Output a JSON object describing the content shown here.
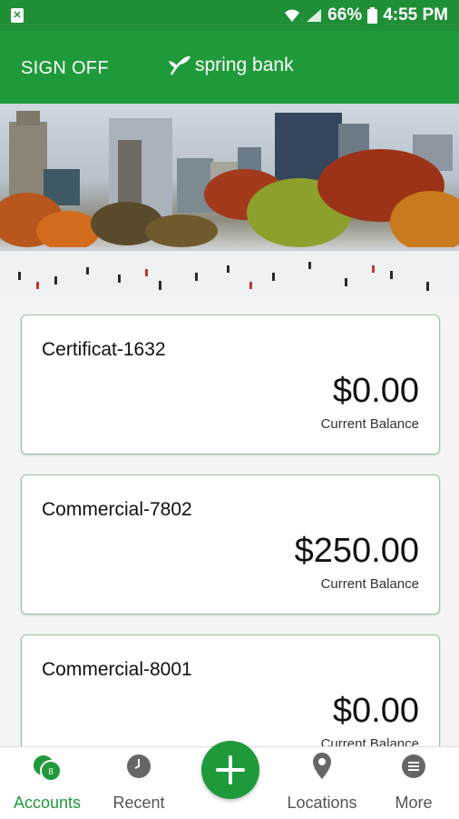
{
  "status": {
    "battery": "66%",
    "time": "4:55 PM"
  },
  "header": {
    "sign_off": "SIGN OFF",
    "brand": "spring bank"
  },
  "accounts": [
    {
      "name": "Certificat-1632",
      "amount": "$0.00",
      "balance_label": "Current Balance"
    },
    {
      "name": "Commercial-7802",
      "amount": "$250.00",
      "balance_label": "Current Balance"
    },
    {
      "name": "Commercial-8001",
      "amount": "$0.00",
      "balance_label": "Current Balance"
    }
  ],
  "nav": {
    "accounts": "Accounts",
    "accounts_badge": "8",
    "recent": "Recent",
    "locations": "Locations",
    "more": "More"
  },
  "colors": {
    "brand_green": "#1f9a3a",
    "card_border": "#8fc79a"
  },
  "icons": [
    "notification-icon",
    "wifi-icon",
    "signal-icon",
    "battery-icon",
    "sprout-logo-icon",
    "accounts-icon",
    "clock-icon",
    "plus-icon",
    "location-pin-icon",
    "menu-icon"
  ]
}
